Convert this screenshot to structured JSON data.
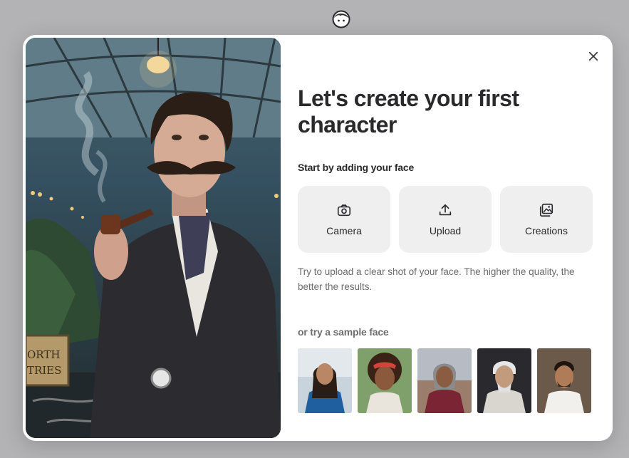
{
  "header": {
    "avatar_icon": "face-icon"
  },
  "modal": {
    "close_icon": "close-icon",
    "title": "Let's create your first character",
    "subtitle": "Start by adding your face",
    "options": [
      {
        "label": "Camera",
        "icon": "camera-icon"
      },
      {
        "label": "Upload",
        "icon": "upload-icon"
      },
      {
        "label": "Creations",
        "icon": "gallery-icon"
      }
    ],
    "hint": "Try to upload a clear shot of your face. The higher the quality, the better the results.",
    "sample_label": "or try a sample face",
    "hero_sign_lines": [
      "ORTH",
      "TRIES"
    ]
  }
}
